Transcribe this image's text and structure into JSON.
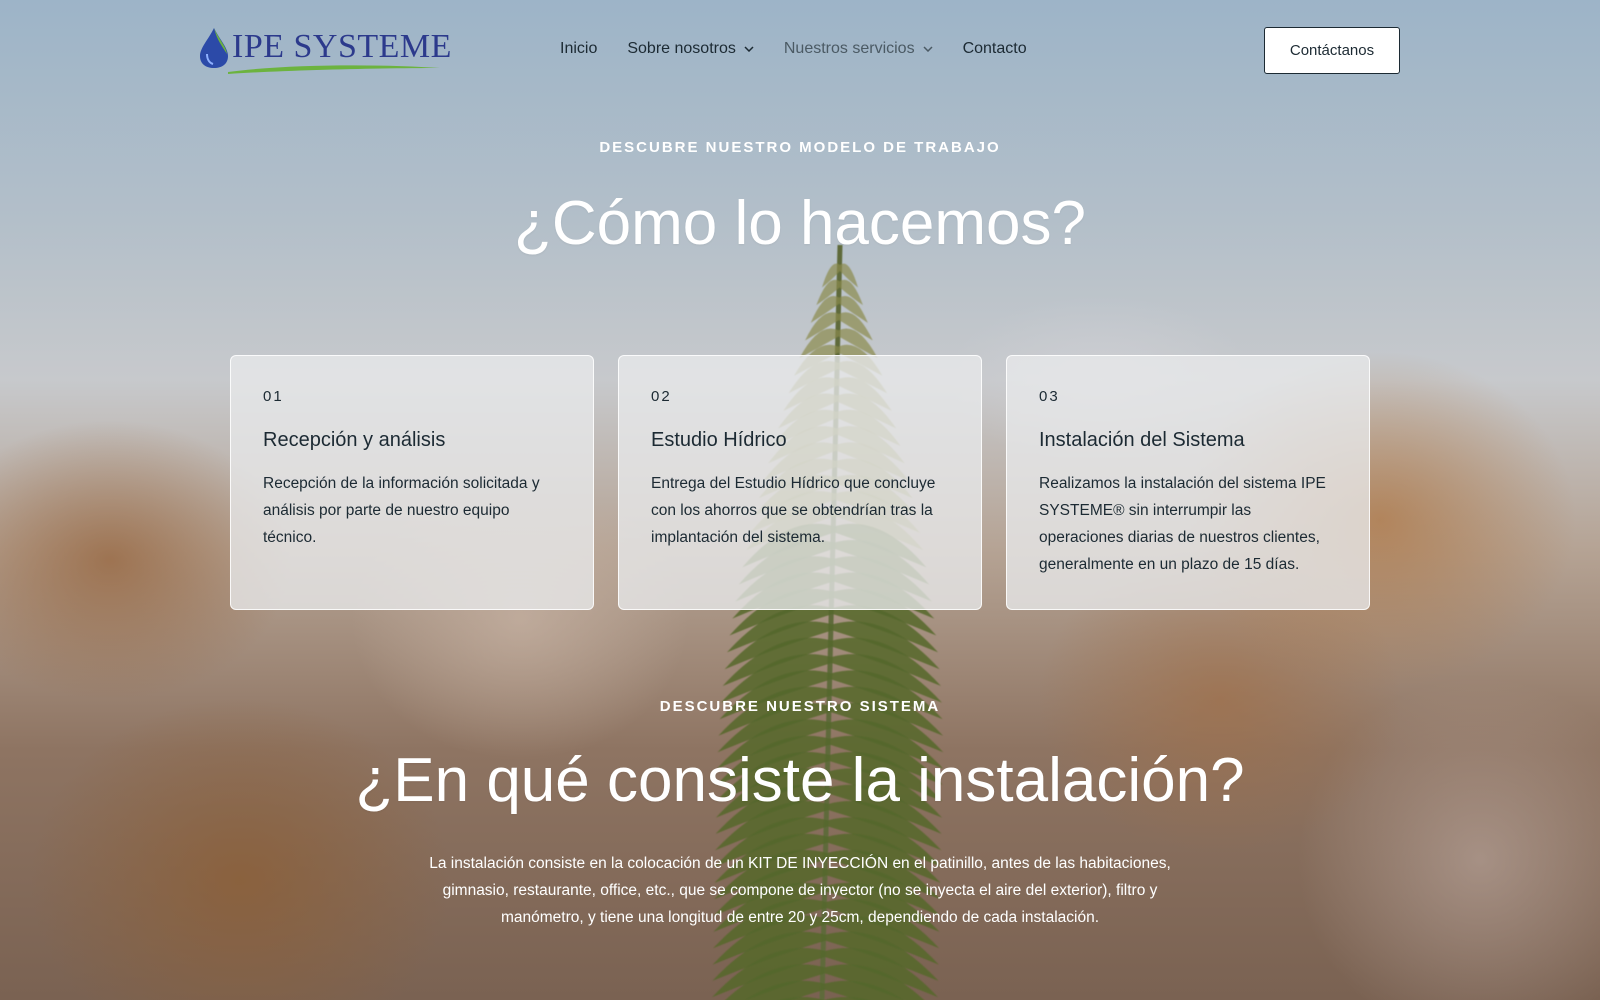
{
  "header": {
    "logo_text": "IPE SYSTEME",
    "nav": [
      {
        "label": "Inicio",
        "has_dropdown": false
      },
      {
        "label": "Sobre nosotros",
        "has_dropdown": true
      },
      {
        "label": "Nuestros servicios",
        "has_dropdown": true
      },
      {
        "label": "Contacto",
        "has_dropdown": false
      }
    ],
    "cta_label": "Contáctanos"
  },
  "section_work": {
    "eyebrow": "DESCUBRE NUESTRO MODELO DE TRABAJO",
    "title": "¿Cómo lo hacemos?",
    "cards": [
      {
        "num": "01",
        "title": "Recepción y análisis",
        "text": "Recepción de la información solicitada y análisis por parte de nuestro equipo técnico."
      },
      {
        "num": "02",
        "title": "Estudio Hídrico",
        "text": "Entrega del Estudio Hídrico que concluye con los ahorros que se obtendrían tras la implantación del sistema."
      },
      {
        "num": "03",
        "title": "Instalación del Sistema",
        "text": "Realizamos la instalación del sistema IPE SYSTEME® sin interrumpir las operaciones diarias de nuestros clientes, generalmente en un plazo de 15 días."
      }
    ]
  },
  "section_system": {
    "eyebrow": "DESCUBRE NUESTRO SISTEMA",
    "title": "¿En qué consiste la instalación?",
    "paragraph": "La instalación consiste en la colocación de un KIT DE INYECCIÓN en el patinillo, antes de las habitaciones, gimnasio, restaurante, office, etc., que se compone de inyector (no se inyecta el aire del exterior), filtro y manómetro, y tiene una longitud de entre 20 y 25cm, dependiendo de cada instalación."
  },
  "colors": {
    "logo_blue": "#2c3a8c",
    "logo_green": "#6cb33f",
    "text_dark": "#1c2a33"
  }
}
